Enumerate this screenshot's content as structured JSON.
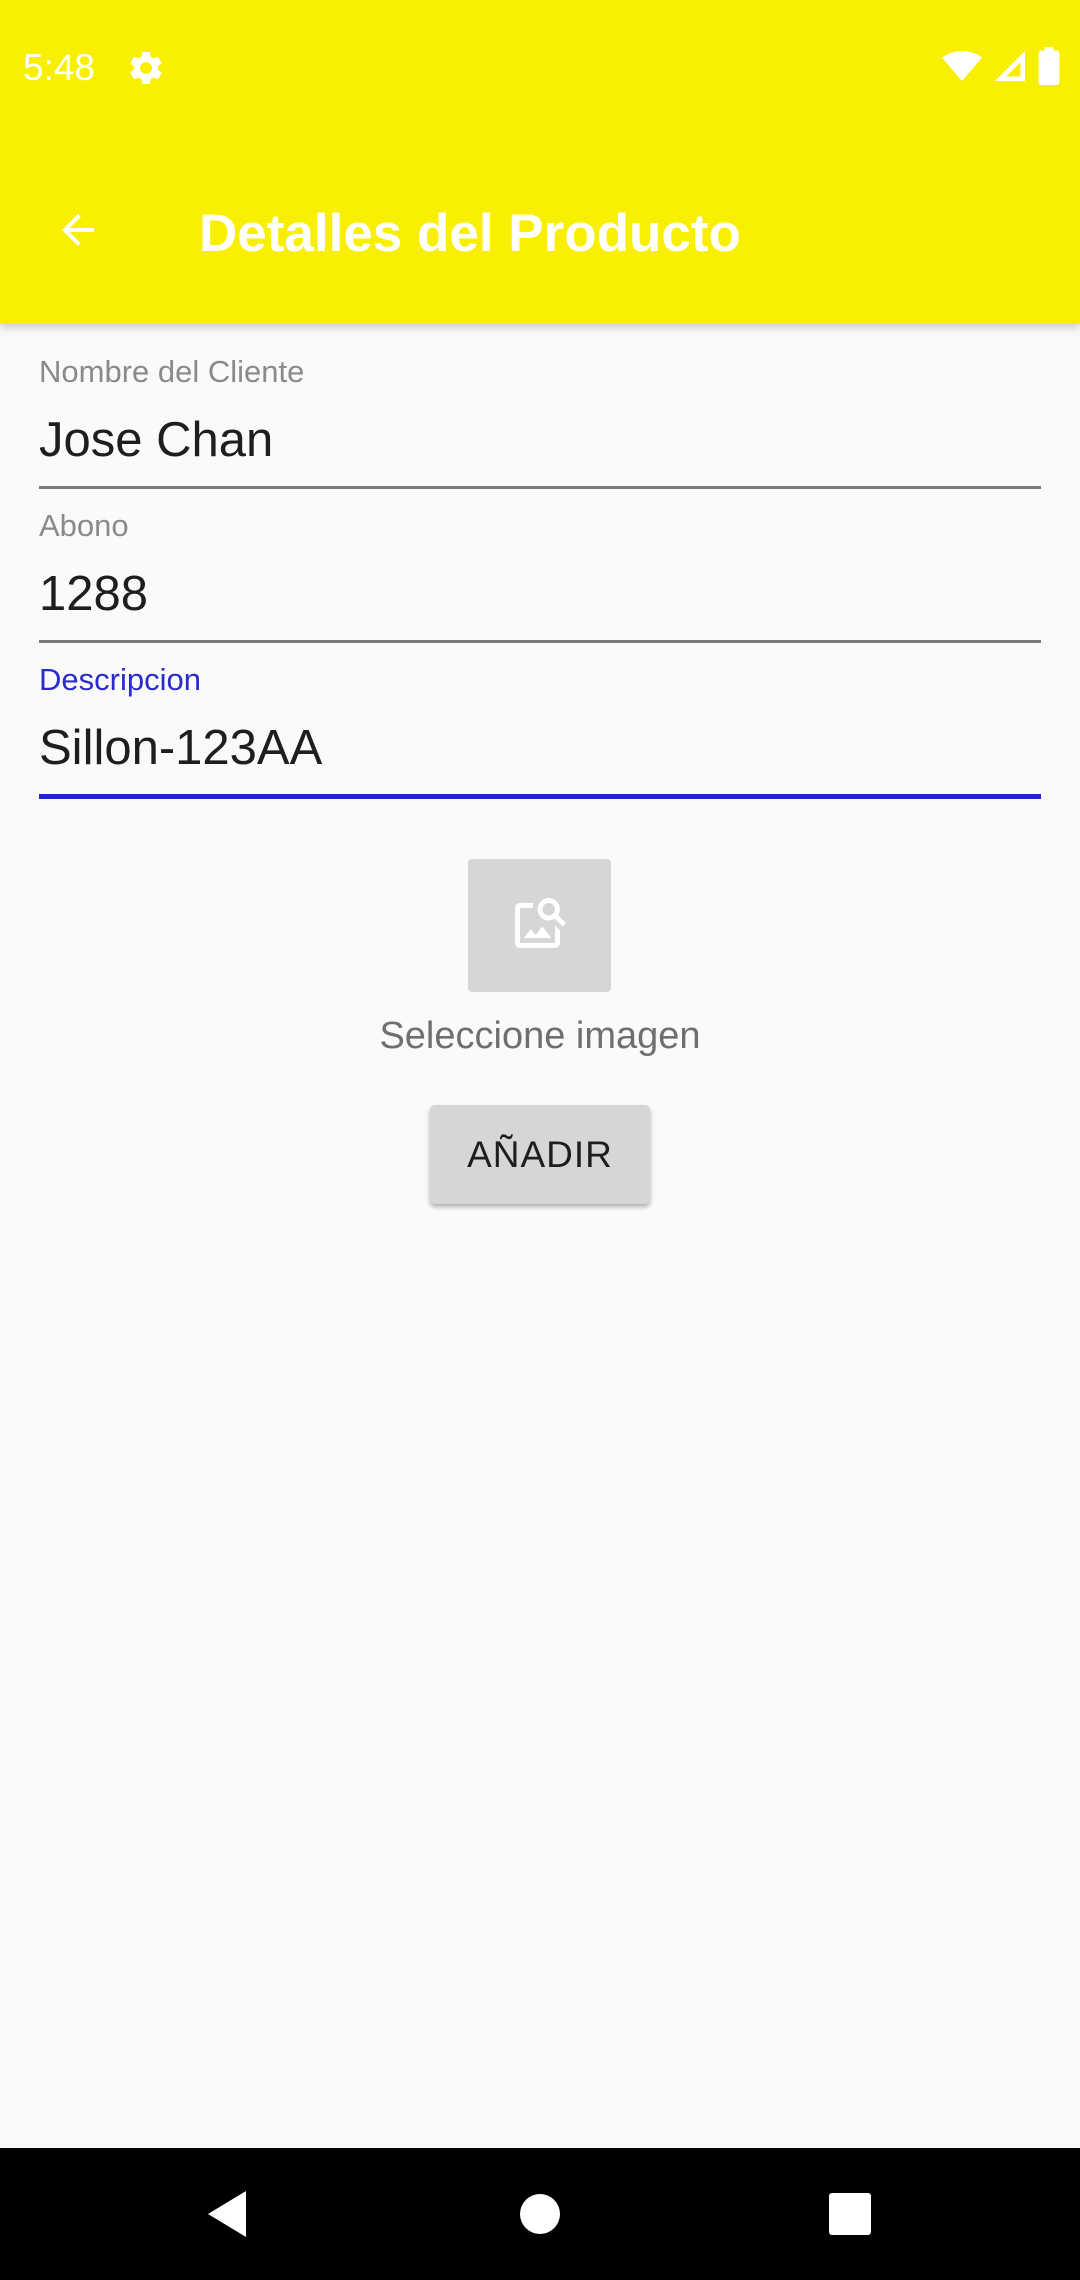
{
  "status_bar": {
    "time": "5:48",
    "icons": [
      "gear-icon",
      "wifi-icon",
      "signal-icon",
      "battery-icon"
    ]
  },
  "app_bar": {
    "title": "Detalles del Producto",
    "back_icon": "arrow-back-icon",
    "background_color": "#f9ef00"
  },
  "form": {
    "cliente": {
      "label": "Nombre del Cliente",
      "value": "Jose Chan"
    },
    "abono": {
      "label": "Abono",
      "value": "1288"
    },
    "descripcion": {
      "label": "Descripcion",
      "value": "Sillon-123AA",
      "focused": true,
      "accent_color": "#2424c8"
    }
  },
  "image_picker": {
    "icon": "image-search-icon",
    "caption": "Seleccione imagen"
  },
  "add_button": {
    "label": "AÑADIR"
  },
  "nav_bar": {
    "icons": [
      "back-triangle-icon",
      "home-circle-icon",
      "recents-square-icon"
    ]
  }
}
